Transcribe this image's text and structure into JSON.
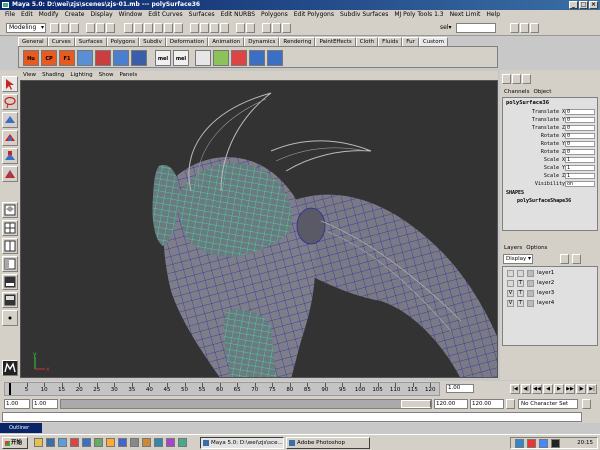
{
  "window": {
    "title": "Maya 5.0: D:\\wei\\zjs\\scenes\\zjs-01.mb  ---  polySurface36",
    "buttons": [
      "_",
      "□",
      "×"
    ]
  },
  "menu": [
    "File",
    "Edit",
    "Modify",
    "Create",
    "Display",
    "Window",
    "Edit Curves",
    "Surfaces",
    "Edit NURBS",
    "Polygons",
    "Edit Polygons",
    "Subdiv Surfaces",
    "MJ Poly Tools 1.3",
    "Next Limit",
    "Help"
  ],
  "status": {
    "mode": "Modeling",
    "sel_label": "sel▾"
  },
  "shelf_tabs": [
    "General",
    "Curves",
    "Surfaces",
    "Polygons",
    "Subdiv",
    "Deformation",
    "Animation",
    "Dynamics",
    "Rendering",
    "PaintEffects",
    "Cloth",
    "Fluids",
    "Fur",
    "Custom"
  ],
  "shelf_icons": [
    {
      "label": "Hu",
      "color": "#e85a1e"
    },
    {
      "label": "CP",
      "color": "#e85a1e"
    },
    {
      "label": "F1",
      "color": "#e85a1e"
    },
    {
      "label": "",
      "color": "#5a8fd4"
    },
    {
      "label": "",
      "color": "#c93e3e"
    },
    {
      "label": "",
      "color": "#4a7fcf"
    },
    {
      "label": "",
      "color": "#3a5fa8"
    },
    {
      "label": "mel",
      "color": "#f0f0f0"
    },
    {
      "label": "mel",
      "color": "#f0f0f0"
    },
    {
      "label": "",
      "color": "#e6e6e6"
    },
    {
      "label": "",
      "color": "#8ac35a"
    },
    {
      "label": "",
      "color": "#d44"
    },
    {
      "label": "",
      "color": "#3a6fc4"
    },
    {
      "label": "",
      "color": "#3a6fc4"
    }
  ],
  "panel_menu": [
    "View",
    "Shading",
    "Lighting",
    "Show",
    "Panels"
  ],
  "channel_box": {
    "tabs": [
      "Channels",
      "Object"
    ],
    "object_name": "polySurface36",
    "attributes": [
      {
        "label": "Translate X",
        "value": "0"
      },
      {
        "label": "Translate Y",
        "value": "0"
      },
      {
        "label": "Translate Z",
        "value": "0"
      },
      {
        "label": "Rotate X",
        "value": "0"
      },
      {
        "label": "Rotate Y",
        "value": "0"
      },
      {
        "label": "Rotate Z",
        "value": "0"
      },
      {
        "label": "Scale X",
        "value": "1"
      },
      {
        "label": "Scale Y",
        "value": "1"
      },
      {
        "label": "Scale Z",
        "value": "1"
      },
      {
        "label": "Visibility",
        "value": "on"
      }
    ],
    "shapes_header": "SHAPES",
    "shape_name": "polySurfaceShape36"
  },
  "layers": {
    "tabs": [
      "Layers",
      "Options"
    ],
    "display": "Display",
    "items": [
      {
        "name": "layer1",
        "v": "",
        "t": ""
      },
      {
        "name": "layer2",
        "v": "",
        "t": "T"
      },
      {
        "name": "layer3",
        "v": "V",
        "t": "T"
      },
      {
        "name": "layer4",
        "v": "V",
        "t": "T"
      }
    ]
  },
  "timeline": {
    "ticks": [
      "5",
      "10",
      "15",
      "20",
      "25",
      "30",
      "35",
      "40",
      "45",
      "50",
      "55",
      "60",
      "65",
      "70",
      "75",
      "80",
      "85",
      "90",
      "95",
      "100",
      "105",
      "110",
      "115",
      "120"
    ],
    "current_frame": "1.00",
    "play_icons": [
      "|◀",
      "◀|",
      "◀◀",
      "◀",
      "▶",
      "▶▶",
      "|▶",
      "▶|"
    ]
  },
  "range": {
    "start": "1.00",
    "range_start": "1.00",
    "range_end": "120.00",
    "end": "120.00",
    "char_set": "No Character Set"
  },
  "taskbar": {
    "start": "开始",
    "outliner": "Outliner",
    "tasks": [
      "Maya 5.0: D:\\wei\\zjs\\sce...",
      "Adobe Photoshop"
    ],
    "clock": "20:15"
  },
  "colors": {
    "viewport_bg": "#333333",
    "wire_selected": "#3fe8a8",
    "wire_unselected": "#2a2aa0",
    "mesh_shade": "#7a7a86"
  }
}
